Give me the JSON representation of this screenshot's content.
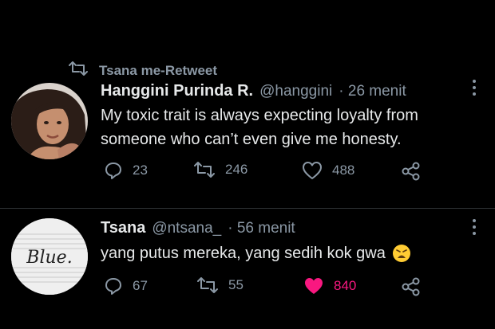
{
  "tweet1": {
    "retweet_label": "Tsana me-Retweet",
    "author_name": "Hanggini Purinda R.",
    "handle": "@hanggini",
    "time": "· 26 menit",
    "text_line1": "My toxic trait is always expecting loyalty from",
    "text_line2": "someone who can’t even give me honesty.",
    "replies": "23",
    "retweets": "246",
    "likes": "488"
  },
  "tweet2": {
    "author_name": "Tsana",
    "handle": "@ntsana_",
    "time": "· 56 menit",
    "text": "yang putus mereka, yang sedih kok gwa",
    "avatar_text": "Blue.",
    "replies": "67",
    "retweets": "55",
    "likes": "840",
    "liked": true
  },
  "colors": {
    "background": "#000000",
    "text_primary": "#e7e9ea",
    "text_secondary": "#8b98a5",
    "like_active": "#f91880",
    "divider": "#2f3336"
  },
  "icons": [
    "retweet-icon",
    "reply-icon",
    "like-icon",
    "share-icon",
    "more-icon",
    "weary-face-emoji"
  ]
}
